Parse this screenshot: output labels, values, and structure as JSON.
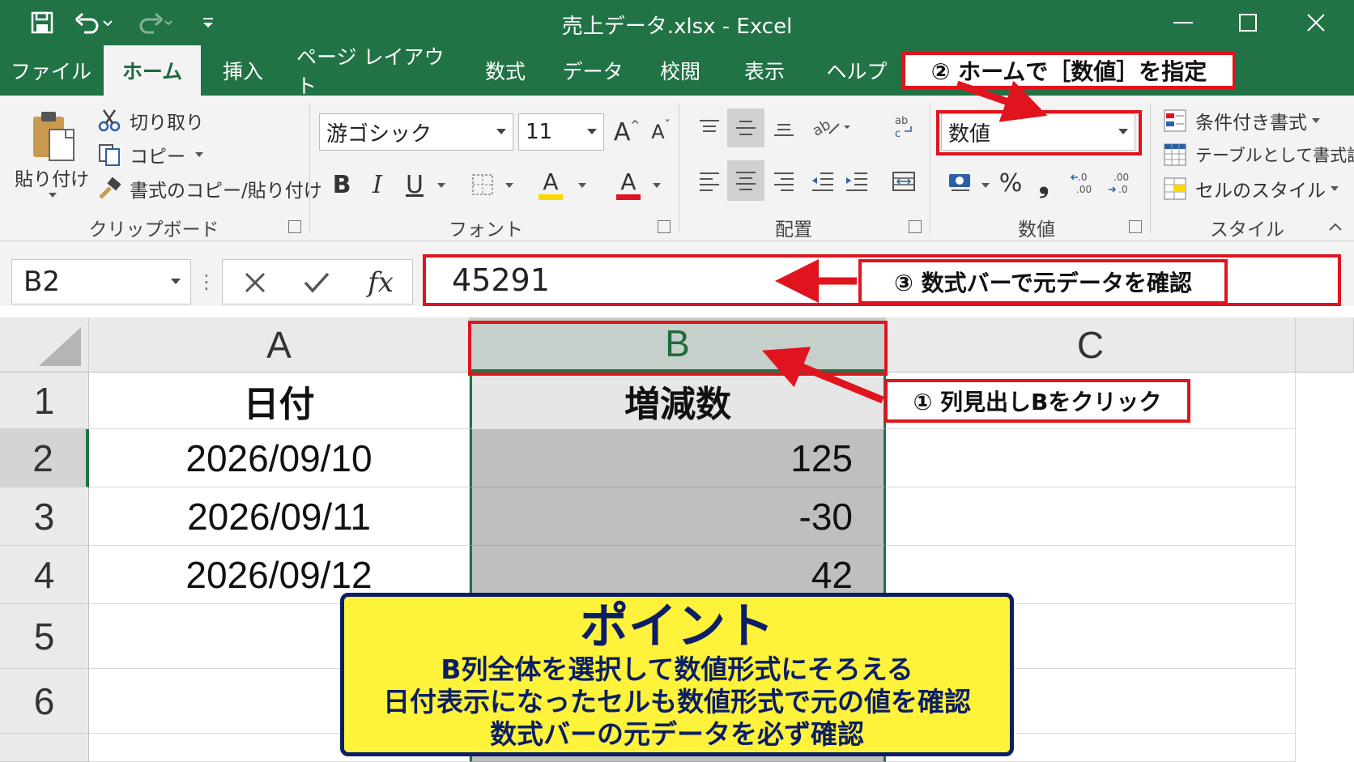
{
  "titlebar": {
    "title": "売上データ.xlsx  -  Excel",
    "accent_color": "#217346",
    "qat_icons": [
      "save-icon",
      "undo-icon",
      "redo-icon",
      "customize-icon"
    ],
    "window_controls": [
      "minimize-icon",
      "maximize-icon",
      "close-icon"
    ]
  },
  "menu": {
    "tabs": [
      {
        "label": "ファイル",
        "active": false
      },
      {
        "label": "ホーム",
        "active": true
      },
      {
        "label": "挿入",
        "active": false
      },
      {
        "label": "ページ レイアウト",
        "active": false
      },
      {
        "label": "数式",
        "active": false
      },
      {
        "label": "データ",
        "active": false
      },
      {
        "label": "校閲",
        "active": false
      },
      {
        "label": "表示",
        "active": false
      },
      {
        "label": "ヘルプ",
        "active": false
      }
    ]
  },
  "ribbon": {
    "clipboard": {
      "group_label": "クリップボード",
      "paste_label": "貼り付け",
      "cut_label": "切り取り",
      "copy_label": "コピー",
      "format_painter_label": "書式のコピー/貼り付け"
    },
    "font": {
      "group_label": "フォント",
      "font_name": "游ゴシック",
      "font_size": "11",
      "bold": "B",
      "italic": "I",
      "underline": "U",
      "font_color_glyph": "A",
      "highlight_color": "#ffd700",
      "font_color": "#e0141e"
    },
    "alignment": {
      "group_label": "配置"
    },
    "number": {
      "group_label": "数値",
      "format_value": "数値",
      "percent": "%",
      "comma": "❟"
    },
    "styles": {
      "group_label": "スタイル",
      "conditional_label": "条件付き書式",
      "table_label": "テーブルとして書式設定",
      "cell_styles_label": "セルのスタイル"
    }
  },
  "formula_bar": {
    "name_box": "B2",
    "fx": "fx",
    "value": "45291"
  },
  "sheet": {
    "columns": [
      "A",
      "B",
      "C"
    ],
    "rows": [
      "1",
      "2",
      "3",
      "4",
      "5",
      "6"
    ],
    "header_row": {
      "a": "日付",
      "b": "増減数"
    },
    "data": [
      {
        "a": "2026/09/10",
        "b": "125"
      },
      {
        "a": "2026/09/11",
        "b": "-30"
      },
      {
        "a": "2026/09/12",
        "b": "42"
      }
    ],
    "selected_column": "B",
    "selection_fill": "#bfbfbf"
  },
  "annotations": {
    "step1": "① 列見出しBをクリック",
    "step2": "② ホームで［数値］を指定",
    "step3": "③ 数式バーで元データを確認",
    "callout_color": "#e0141e"
  },
  "point": {
    "title": "ポイント",
    "lines": [
      "B列全体を選択して数値形式にそろえる",
      "日付表示になったセルも数値形式で元の値を確認",
      "数式バーの元データを必ず確認"
    ],
    "fill": "#fff23a",
    "border": "#0b1e66"
  }
}
